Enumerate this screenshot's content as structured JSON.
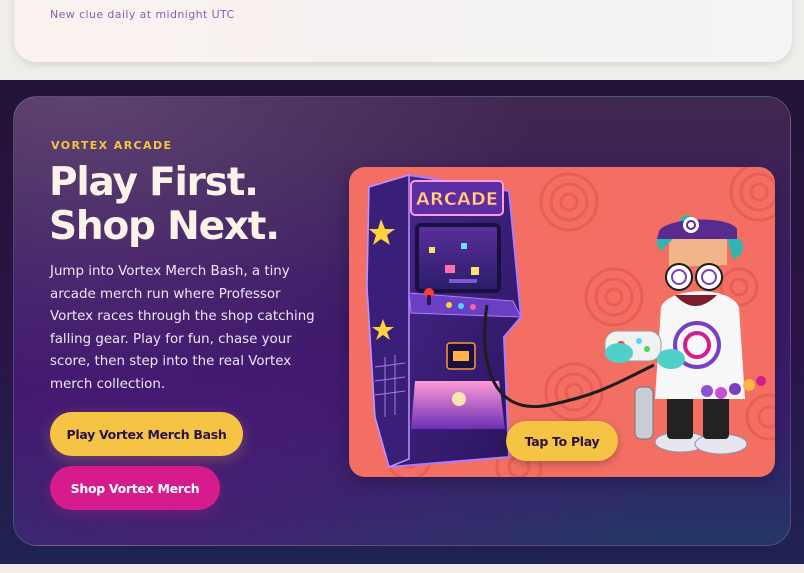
{
  "top_card": {
    "note": "New clue daily at midnight UTC"
  },
  "arcade": {
    "eyebrow": "VORTEX ARCADE",
    "headline_line1": "Play First.",
    "headline_line2": "Shop Next.",
    "body": "Jump into Vortex Merch Bash, a tiny arcade merch run where Professor Vortex races through the shop catching falling gear. Play for fun, chase your score, then step into the real Vortex merch collection.",
    "play_button": "Play Vortex Merch Bash",
    "shop_button": "Shop Vortex Merch",
    "game": {
      "cabinet_marquee": "ARCADE",
      "tap_button": "Tap To Play"
    }
  },
  "colors": {
    "accent_yellow": "#f6c445",
    "accent_magenta": "#d61c8d",
    "panel_coral": "#f36f63",
    "section_purple": "#3a1c6e"
  },
  "icons": [
    "arcade-cabinet-illustration",
    "professor-vortex-character-illustration",
    "swirl-pattern"
  ]
}
